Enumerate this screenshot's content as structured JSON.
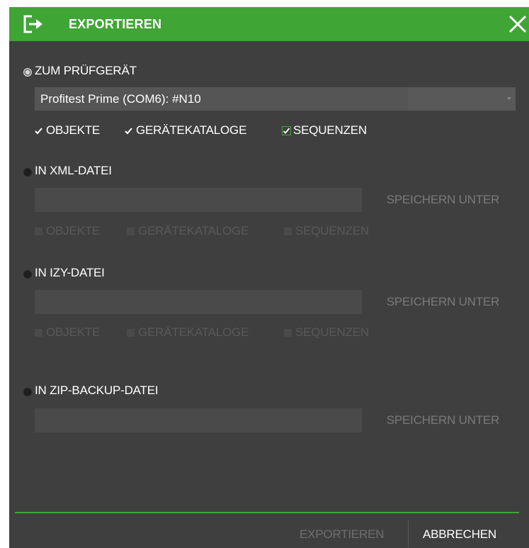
{
  "dialog": {
    "title": "EXPORTIEREN",
    "title_icon": "export-icon",
    "close_icon": "close-icon",
    "colors": {
      "accent": "#3fa535",
      "background": "#3f3f3f",
      "field": "#4a4a4a",
      "disabled_text": "#595959"
    }
  },
  "sections": {
    "device": {
      "label": "ZUM PRÜFGERÄT",
      "selected": true,
      "select_value": "Profitest Prime (COM6): #N10",
      "checkboxes": [
        {
          "label": "OBJEKTE",
          "checked": true
        },
        {
          "label": "GERÄTEKATALOGE",
          "checked": true
        },
        {
          "label": "SEQUENZEN",
          "checked": true
        }
      ]
    },
    "xml": {
      "label": "IN XML-DATEI",
      "selected": false,
      "path_value": "",
      "save_label": "SPEICHERN UNTER",
      "checkboxes": [
        {
          "label": "OBJEKTE",
          "checked": false
        },
        {
          "label": "GERÄTEKATALOGE",
          "checked": false
        },
        {
          "label": "SEQUENZEN",
          "checked": false
        }
      ]
    },
    "izy": {
      "label": "IN IZY-DATEI",
      "selected": false,
      "path_value": "",
      "save_label": "SPEICHERN UNTER",
      "checkboxes": [
        {
          "label": "OBJEKTE",
          "checked": false
        },
        {
          "label": "GERÄTEKATALOGE",
          "checked": false
        },
        {
          "label": "SEQUENZEN",
          "checked": false
        }
      ]
    },
    "zip": {
      "label": "IN ZIP-BACKUP-DATEI",
      "selected": false,
      "path_value": "",
      "save_label": "SPEICHERN UNTER"
    }
  },
  "footer": {
    "export_label": "EXPORTIEREN",
    "cancel_label": "ABBRECHEN"
  }
}
